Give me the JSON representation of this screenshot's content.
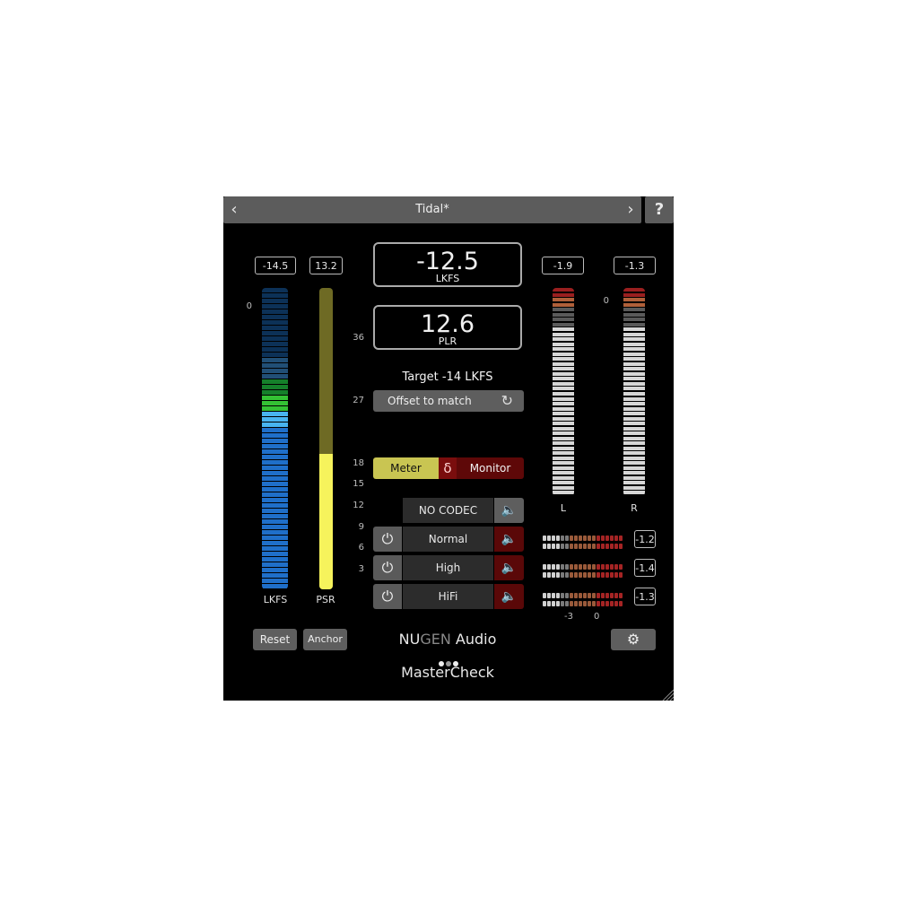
{
  "preset": {
    "name": "Tidal*",
    "prev_icon": "chevron-left-icon",
    "next_icon": "chevron-right-icon",
    "help_label": "?"
  },
  "left_meters": {
    "lkfs_value": "-14.5",
    "psr_value": "13.2",
    "lkfs_label": "LKFS",
    "psr_label": "PSR",
    "lkfs_zero_label": "0",
    "scale": [
      "36",
      "27",
      "18",
      "15",
      "12",
      "9",
      "6",
      "3"
    ],
    "psr_level_fraction": 0.45
  },
  "center": {
    "loudness_value": "-12.5",
    "loudness_unit": "LKFS",
    "plr_value": "12.6",
    "plr_unit": "PLR",
    "target_text": "Target -14 LKFS",
    "offset_label": "Offset to match",
    "offset_icon": "refresh-icon",
    "meter_label": "Meter",
    "delta_label": "δ",
    "monitor_label": "Monitor"
  },
  "codecs": [
    {
      "name": "NO CODEC",
      "has_power": false,
      "monitoring": true
    },
    {
      "name": "Normal",
      "has_power": true,
      "monitoring": false
    },
    {
      "name": "High",
      "has_power": true,
      "monitoring": false
    },
    {
      "name": "HiFi",
      "has_power": true,
      "monitoring": false
    }
  ],
  "right_meters": {
    "left_value": "-1.9",
    "right_value": "-1.3",
    "left_label": "L",
    "right_label": "R",
    "zero_label": "0",
    "codec_peak_values": [
      "-1.2",
      "-1.4",
      "-1.3"
    ],
    "mini_scale": [
      "-3",
      "0"
    ]
  },
  "buttons": {
    "reset": "Reset",
    "anchor": "Anchor",
    "settings_icon": "gear-icon"
  },
  "brand": {
    "nu": "NU",
    "gen": "GEN",
    "audio": " Audio",
    "product": "MasterCheck"
  },
  "colors": {
    "accent_yellow": "#c9c552",
    "monitor_red": "#5e0808",
    "meter_blue": "#1f6fc9",
    "meter_green": "#2fb82f",
    "meter_cyan": "#48b4f0"
  }
}
